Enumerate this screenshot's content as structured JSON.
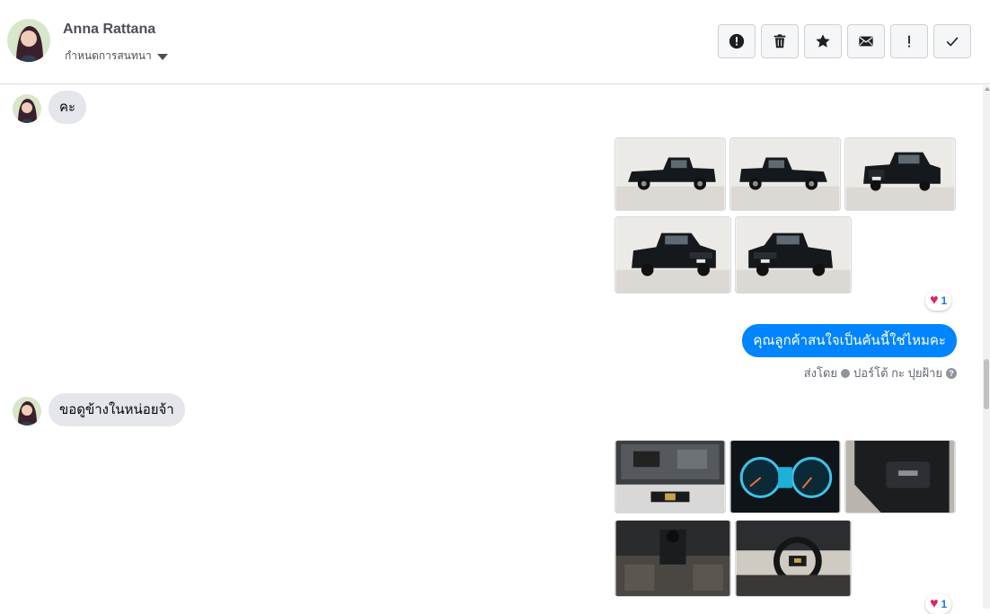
{
  "header": {
    "contact_name": "Anna Rattana",
    "assign_label": "กำหนดการสนทนา",
    "actions": [
      {
        "name": "spam-icon",
        "label": "!"
      },
      {
        "name": "trash-icon",
        "label": "delete"
      },
      {
        "name": "star-icon",
        "label": "star"
      },
      {
        "name": "envelope-icon",
        "label": "unread"
      },
      {
        "name": "follow-up-icon",
        "label": "!"
      },
      {
        "name": "check-icon",
        "label": "done"
      }
    ]
  },
  "messages": {
    "incoming_1": "คะ",
    "photos_1": [
      "car-side-left",
      "car-side-right",
      "car-rear",
      "car-front-left",
      "car-front-right"
    ],
    "reaction_1": {
      "icon": "heart-icon",
      "count": "1"
    },
    "outgoing_1": "คุณลูกค้าสนใจเป็นคันนี้ใช่ไหมคะ",
    "sent_by_prefix": "ส่งโดย",
    "sent_by_name": "ปอร์โต้ กะ ปุยฝ้าย",
    "incoming_2": "ขอดูข้างในหน่อยจ้า",
    "photos_2": [
      "engine-bay",
      "dashboard-gauges",
      "door-panel",
      "gear-shift",
      "steering-wheel"
    ],
    "reaction_2": {
      "icon": "heart-icon",
      "count": "1"
    }
  },
  "colors": {
    "accent": "#0084ff",
    "bubble_in": "#e4e6eb",
    "reaction_heart": "#e0245e"
  }
}
